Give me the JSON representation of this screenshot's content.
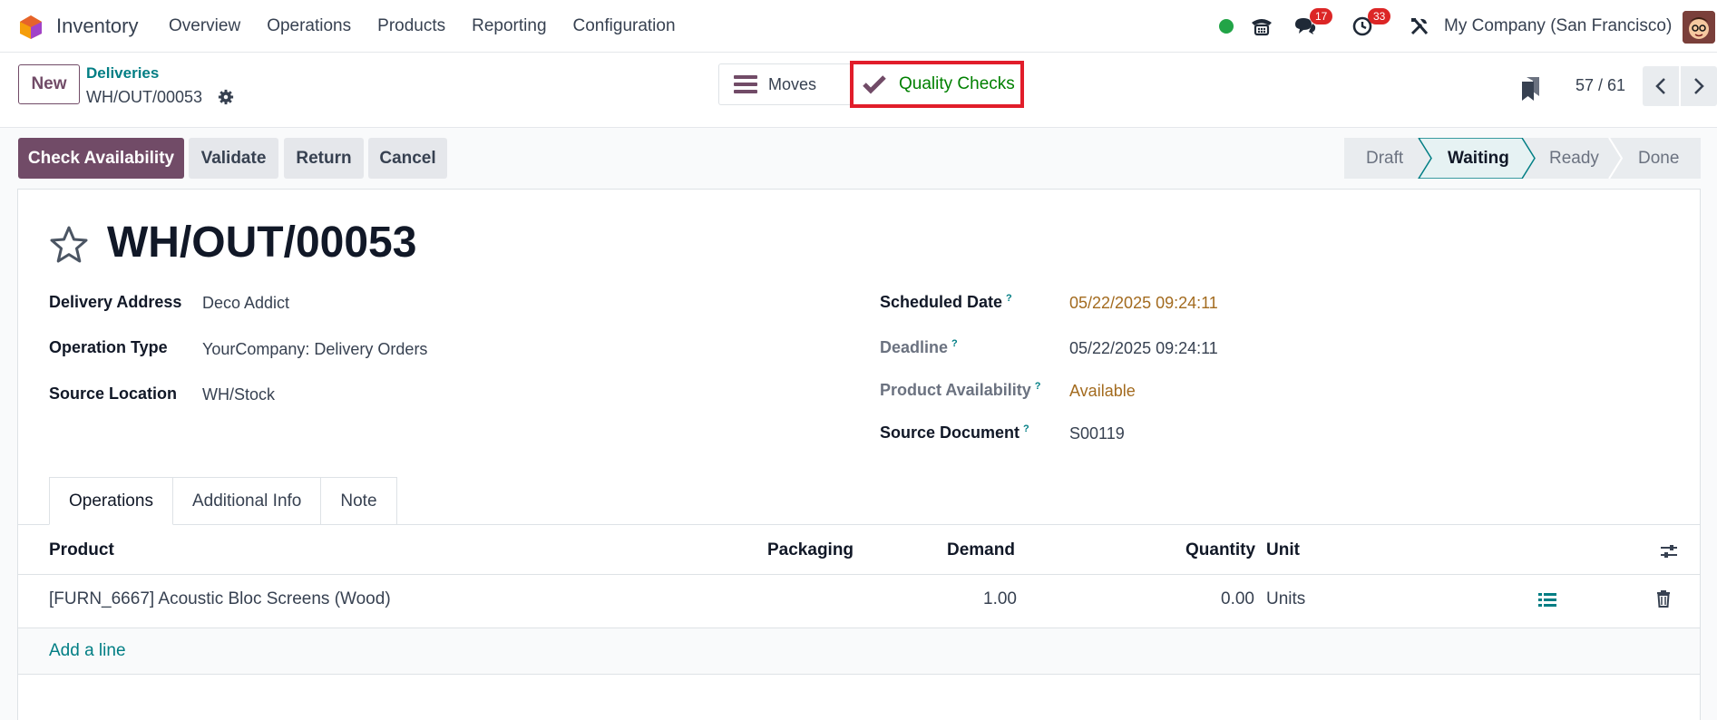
{
  "navbar": {
    "app_name": "Inventory",
    "menu": [
      "Overview",
      "Operations",
      "Products",
      "Reporting",
      "Configuration"
    ],
    "messages_count": "17",
    "activities_count": "33",
    "company": "My Company (San Francisco)",
    "status_color": "#22a447"
  },
  "control_panel": {
    "new_label": "New",
    "breadcrumb_parent": "Deliveries",
    "breadcrumb_current": "WH/OUT/00053",
    "smart_moves": "Moves",
    "smart_quality": "Quality Checks",
    "pager": "57 / 61"
  },
  "actions": {
    "check_availability": "Check Availability",
    "validate": "Validate",
    "return": "Return",
    "cancel": "Cancel"
  },
  "stages": [
    "Draft",
    "Waiting",
    "Ready",
    "Done"
  ],
  "current_stage": "Waiting",
  "record": {
    "title": "WH/OUT/00053",
    "delivery_address_label": "Delivery Address",
    "delivery_address": "Deco Addict",
    "operation_type_label": "Operation Type",
    "operation_type": "YourCompany: Delivery Orders",
    "source_location_label": "Source Location",
    "source_location": "WH/Stock",
    "scheduled_date_label": "Scheduled Date",
    "scheduled_date": "05/22/2025 09:24:11",
    "deadline_label": "Deadline",
    "deadline": "05/22/2025 09:24:11",
    "availability_label": "Product Availability",
    "availability": "Available",
    "source_document_label": "Source Document",
    "source_document": "S00119",
    "help_mark": "?"
  },
  "tabs": [
    "Operations",
    "Additional Info",
    "Note"
  ],
  "table": {
    "headers": {
      "product": "Product",
      "packaging": "Packaging",
      "demand": "Demand",
      "quantity": "Quantity",
      "unit": "Unit"
    },
    "rows": [
      {
        "product": "[FURN_6667] Acoustic Bloc Screens (Wood)",
        "demand": "1.00",
        "quantity": "0.00",
        "unit": "Units"
      }
    ],
    "add_line": "Add a line"
  },
  "colors": {
    "brand": "#714b67",
    "link": "#017e84",
    "highlight": "#e11d2a"
  }
}
